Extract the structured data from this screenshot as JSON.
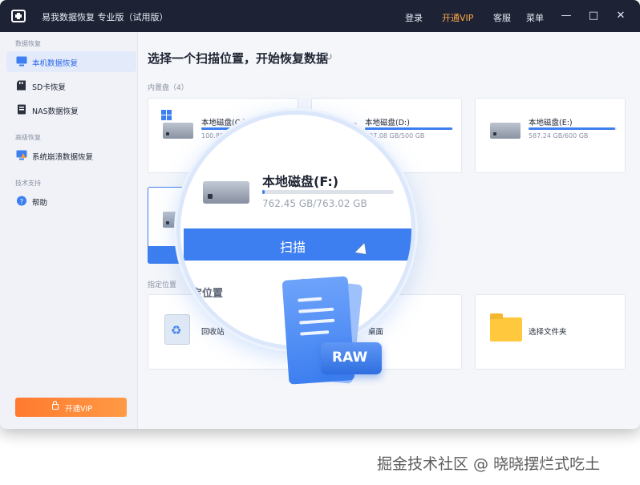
{
  "titlebar": {
    "app_title": "易我数据恢复 专业版（试用版）",
    "login": "登录",
    "vip": "开通VIP",
    "support": "客服",
    "menu": "菜单",
    "minimize": "—",
    "maximize": "□",
    "close": "✕"
  },
  "sidebar": {
    "section_recovery": "数据恢复",
    "section_advanced": "高级恢复",
    "section_support": "技术支持",
    "items": [
      {
        "label": "本机数据恢复",
        "icon": "monitor-icon"
      },
      {
        "label": "SD卡恢复",
        "icon": "sd-card-icon"
      },
      {
        "label": "NAS数据恢复",
        "icon": "nas-icon"
      },
      {
        "label": "系统崩溃数据恢复",
        "icon": "system-crash-icon"
      },
      {
        "label": "帮助",
        "icon": "help-icon"
      }
    ],
    "vip_button": "开通VIP"
  },
  "main": {
    "title": "选择一个扫描位置，开始恢复数据",
    "internal_label": "内置盘（4）",
    "location_label": "指定位置",
    "disks": [
      {
        "name": "本地磁盘(C:)",
        "size": "100.89 GB/2…",
        "fill": 0.55
      },
      {
        "name": "本地磁盘(D:)",
        "size": "497.08 GB/500 GB",
        "fill": 0.99
      },
      {
        "name": "本地磁盘(E:)",
        "size": "587.24 GB/600 GB",
        "fill": 0.98
      }
    ],
    "locations": [
      {
        "name": "回收站",
        "icon": "recycle-bin-icon"
      },
      {
        "name": "桌面",
        "icon": "desktop-icon"
      },
      {
        "name": "选择文件夹",
        "icon": "folder-icon"
      }
    ]
  },
  "magnifier": {
    "disk_name": "本地磁盘(F:)",
    "disk_size": "762.45 GB/763.02 GB",
    "fill": 0.02,
    "scan_button": "扫描",
    "section_text": "定位置"
  },
  "raw_badge": "RAW",
  "watermark": "掘金技术社区 @ 晓晓摆烂式吃土",
  "colors": {
    "accent": "#3d7ff0",
    "titlebar": "#1d2335",
    "vip": "#ff7a2f"
  }
}
